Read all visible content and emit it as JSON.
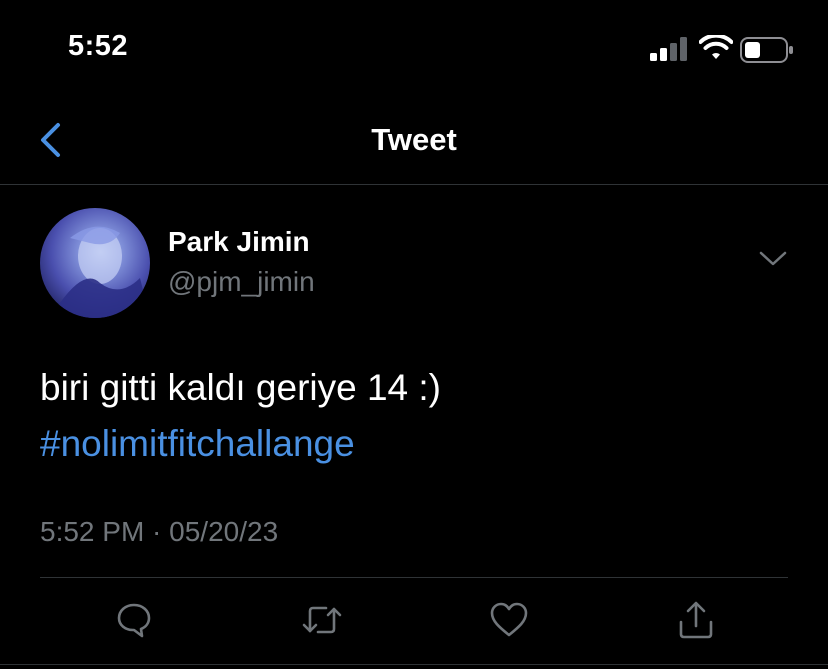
{
  "status_bar": {
    "time": "5:52",
    "icons": [
      "cellular-signal-icon",
      "wifi-icon",
      "battery-icon"
    ]
  },
  "nav": {
    "title": "Tweet",
    "back_icon": "chevron-left-icon"
  },
  "tweet": {
    "author_name": "Park Jimin",
    "author_handle": "@pjm_jimin",
    "text": "biri gitti kaldı geriye 14 :)",
    "hashtag": "#nolimitfitchallange",
    "timestamp": "5:52 PM · 05/20/23",
    "more_icon": "chevron-down-icon"
  },
  "actions": [
    {
      "name": "reply",
      "icon": "reply-icon"
    },
    {
      "name": "retweet",
      "icon": "retweet-icon"
    },
    {
      "name": "like",
      "icon": "heart-icon"
    },
    {
      "name": "share",
      "icon": "share-icon"
    }
  ],
  "colors": {
    "background": "#000000",
    "text": "#ffffff",
    "secondary_text": "#71767b",
    "accent": "#4a90e2",
    "divider": "#2f3336"
  }
}
